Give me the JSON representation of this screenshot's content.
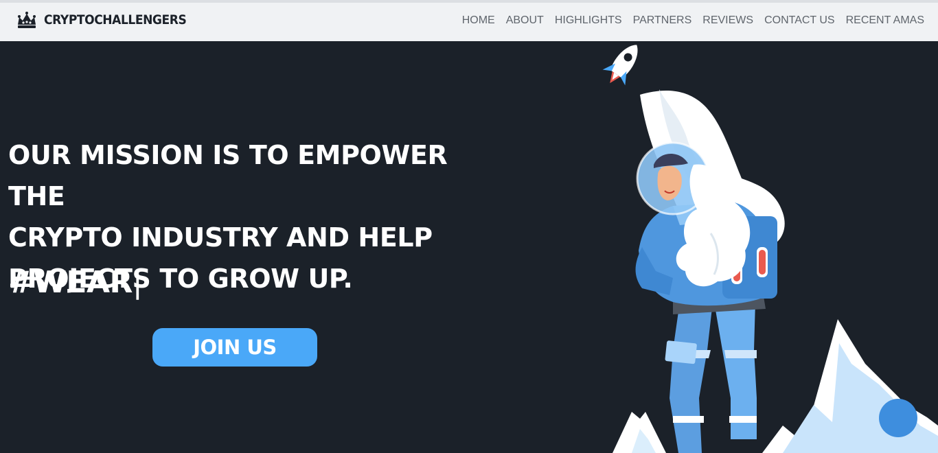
{
  "brand": {
    "name": "CRYPTOCHALLENGERS",
    "logo_icon": "crown-logo-icon"
  },
  "nav": {
    "items": [
      {
        "label": "HOME"
      },
      {
        "label": "ABOUT"
      },
      {
        "label": "HIGHLIGHTS"
      },
      {
        "label": "PARTNERS"
      },
      {
        "label": "REVIEWS"
      },
      {
        "label": "CONTACT US"
      },
      {
        "label": "RECENT AMAS"
      }
    ]
  },
  "hero": {
    "mission_lines": [
      "OUR MISSION IS TO EMPOWER THE",
      "CRYPTO INDUSTRY AND HELP",
      "PROJECTS TO GROW UP."
    ],
    "typed_text": "#WEAR",
    "cursor": "|",
    "cta_label": "JOIN US"
  },
  "colors": {
    "background": "#1b2129",
    "navbar": "#f0f2f4",
    "accent": "#4aa8f8",
    "chat_bubble": "#3e8ede"
  }
}
